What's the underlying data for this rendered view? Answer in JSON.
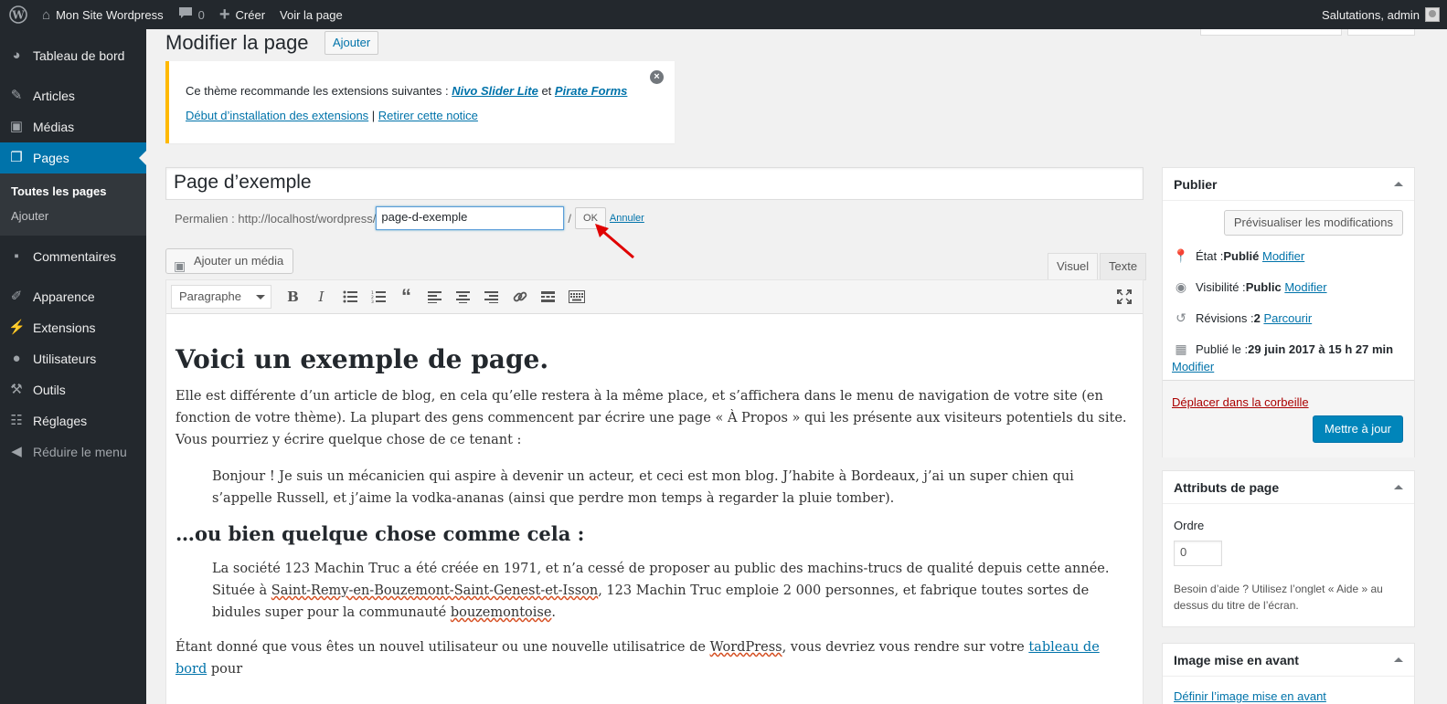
{
  "adminbar": {
    "site_name": "Mon Site Wordpress",
    "comments_count": "0",
    "new_label": "Créer",
    "view_page": "Voir la page",
    "greeting": "Salutations, admin"
  },
  "menu": {
    "dashboard": "Tableau de bord",
    "posts": "Articles",
    "media": "Médias",
    "pages": "Pages",
    "pages_sub": [
      "Toutes les pages",
      "Ajouter"
    ],
    "comments": "Commentaires",
    "appearance": "Apparence",
    "plugins": "Extensions",
    "users": "Utilisateurs",
    "tools": "Outils",
    "settings": "Réglages",
    "collapse": "Réduire le menu"
  },
  "header": {
    "title": "Modifier la page",
    "add_new": "Ajouter"
  },
  "notice": {
    "text": "Ce thème recommande les extensions suivantes : ",
    "plugin1": "Nivo Slider Lite",
    "and": " et ",
    "plugin2": "Pirate Forms",
    "install_link": "Début d’installation des extensions",
    "sep": " | ",
    "dismiss_link": "Retirer cette notice"
  },
  "post": {
    "title": "Page d’exemple",
    "permalink_label": "Permalien : http://localhost/wordpress/",
    "slug": "page-d-exemple",
    "slash": "/",
    "ok": "OK",
    "cancel": "Annuler"
  },
  "editor": {
    "add_media": "Ajouter un média",
    "tab_visual": "Visuel",
    "tab_text": "Texte",
    "format": "Paragraphe",
    "h1": "Voici un exemple de page.",
    "p1": "Elle est différente d’un article de blog, en cela qu’elle restera à la même place, et s’affichera dans le menu de navigation de votre site (en fonction de votre thème). La plupart des gens commencent par écrire une page « À Propos » qui les présente aux visiteurs potentiels du site. Vous pourriez y écrire quelque chose de ce tenant :",
    "quote1": "Bonjour ! Je suis un mécanicien qui aspire à devenir un acteur, et ceci est mon blog. J’habite à Bordeaux, j’ai un super chien qui s’appelle Russell, et j’aime la vodka-ananas (ainsi que perdre mon temps à regarder la pluie tomber).",
    "h2": "…ou bien quelque chose comme cela :",
    "quote2_a": "La société 123 Machin Truc a été créée en 1971, et n’a cessé de proposer au public des machins-trucs de qualité depuis cette année. Située à ",
    "quote2_place": "Saint-Remy-en-Bouzemont-Saint-Genest-et-Isson",
    "quote2_b": ", 123 Machin Truc emploie 2 000 personnes, et fabrique toutes sortes de bidules super pour la communauté ",
    "quote2_word": "bouzemontoise",
    "quote2_c": ".",
    "p2_a": "Étant donné que vous êtes un nouvel utilisateur ou une nouvelle utilisatrice de ",
    "p2_wp": "WordPress",
    "p2_b": ", vous devriez vous rendre sur votre ",
    "p2_link": "tableau de bord",
    "p2_c": " pour"
  },
  "publish": {
    "title": "Publier",
    "preview": "Prévisualiser les modifications",
    "status_label": "État : ",
    "status_value": "Publié",
    "visibility_label": "Visibilité : ",
    "visibility_value": "Public",
    "modify": "Modifier",
    "revisions_label": "Révisions : ",
    "revisions_value": "2",
    "browse": "Parcourir",
    "published_label": "Publié le : ",
    "published_value": "29 juin 2017 à 15 h 27 min",
    "trash": "Déplacer dans la corbeille",
    "update": "Mettre à jour"
  },
  "attributes": {
    "title": "Attributs de page",
    "order_label": "Ordre",
    "order_value": "0",
    "help": "Besoin d’aide ? Utilisez l’onglet « Aide » au dessus du titre de l’écran."
  },
  "featured": {
    "title": "Image mise en avant",
    "set_link": "Définir l’image mise en avant"
  },
  "colors": {
    "adminbar_bg": "#23282d",
    "accent": "#0073aa",
    "primary_button": "#0085ba",
    "notice_border": "#ffb900",
    "trash_link": "#aa0000",
    "annotation_arrow": "#e00000"
  }
}
